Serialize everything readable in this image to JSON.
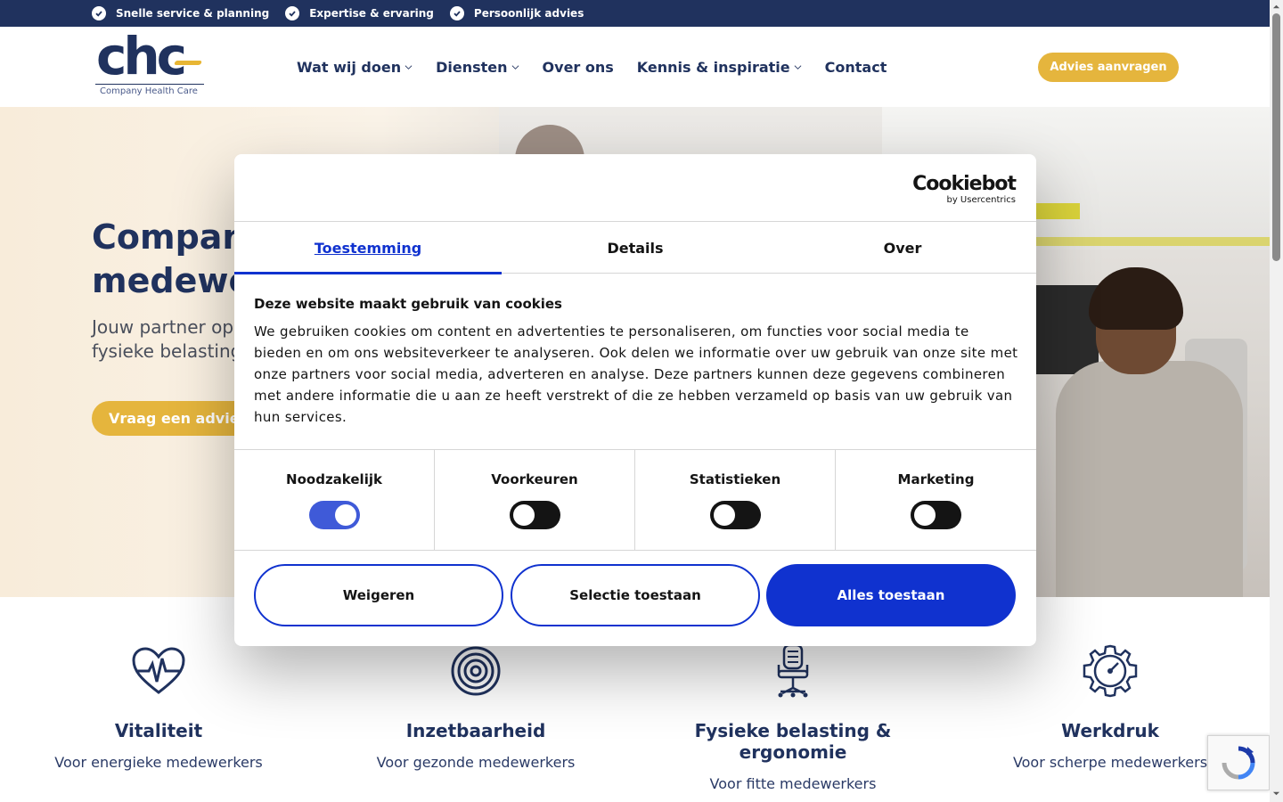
{
  "topbar": {
    "usps": [
      "Snelle service & planning",
      "Expertise & ervaring",
      "Persoonlijk advies"
    ]
  },
  "header": {
    "logo_mark": "chc",
    "logo_tagline": "Company Health Care",
    "nav": [
      {
        "label": "Wat wij doen",
        "has_dropdown": true
      },
      {
        "label": "Diensten",
        "has_dropdown": true
      },
      {
        "label": "Over ons",
        "has_dropdown": false
      },
      {
        "label": "Kennis & inspiratie",
        "has_dropdown": true
      },
      {
        "label": "Contact",
        "has_dropdown": false
      }
    ],
    "cta_label": "Advies aanvragen"
  },
  "hero": {
    "title_line1": "Company",
    "title_line2": "medewe",
    "sub_line1": "Jouw partner op h",
    "sub_line2": "fysieke belasting,",
    "cta_label": "Vraag een advies"
  },
  "features": [
    {
      "icon": "heartbeat-icon",
      "title": "Vitaliteit",
      "subtitle": "Voor energieke medewerkers"
    },
    {
      "icon": "target-icon",
      "title": "Inzetbaarheid",
      "subtitle": "Voor gezonde medewerkers"
    },
    {
      "icon": "office-chair-icon",
      "title": "Fysieke belasting & ergonomie",
      "subtitle": "Voor fitte medewerkers"
    },
    {
      "icon": "gear-gauge-icon",
      "title": "Werkdruk",
      "subtitle": "Voor scherpe medewerkers"
    }
  ],
  "cookie_dialog": {
    "brand": "Cookiebot",
    "brand_sub": "by Usercentrics",
    "tabs": [
      {
        "label": "Toestemming",
        "active": true
      },
      {
        "label": "Details",
        "active": false
      },
      {
        "label": "Over",
        "active": false
      }
    ],
    "title": "Deze website maakt gebruik van cookies",
    "body": "We gebruiken cookies om content en advertenties te personaliseren, om functies voor social media te bieden en om ons websiteverkeer te analyseren. Ook delen we informatie over uw gebruik van onze site met onze partners voor social media, adverteren en analyse. Deze partners kunnen deze gegevens combineren met andere informatie die u aan ze heeft verstrekt of die ze hebben verzameld op basis van uw gebruik van hun services.",
    "categories": [
      {
        "label": "Noodzakelijk",
        "enabled": true
      },
      {
        "label": "Voorkeuren",
        "enabled": false
      },
      {
        "label": "Statistieken",
        "enabled": false
      },
      {
        "label": "Marketing",
        "enabled": false
      }
    ],
    "buttons": {
      "reject": "Weigeren",
      "allow_selection": "Selectie toestaan",
      "allow_all": "Alles toestaan"
    }
  },
  "colors": {
    "navy": "#20325e",
    "gold": "#e5b53d",
    "cookiebot_blue": "#1032cf"
  }
}
